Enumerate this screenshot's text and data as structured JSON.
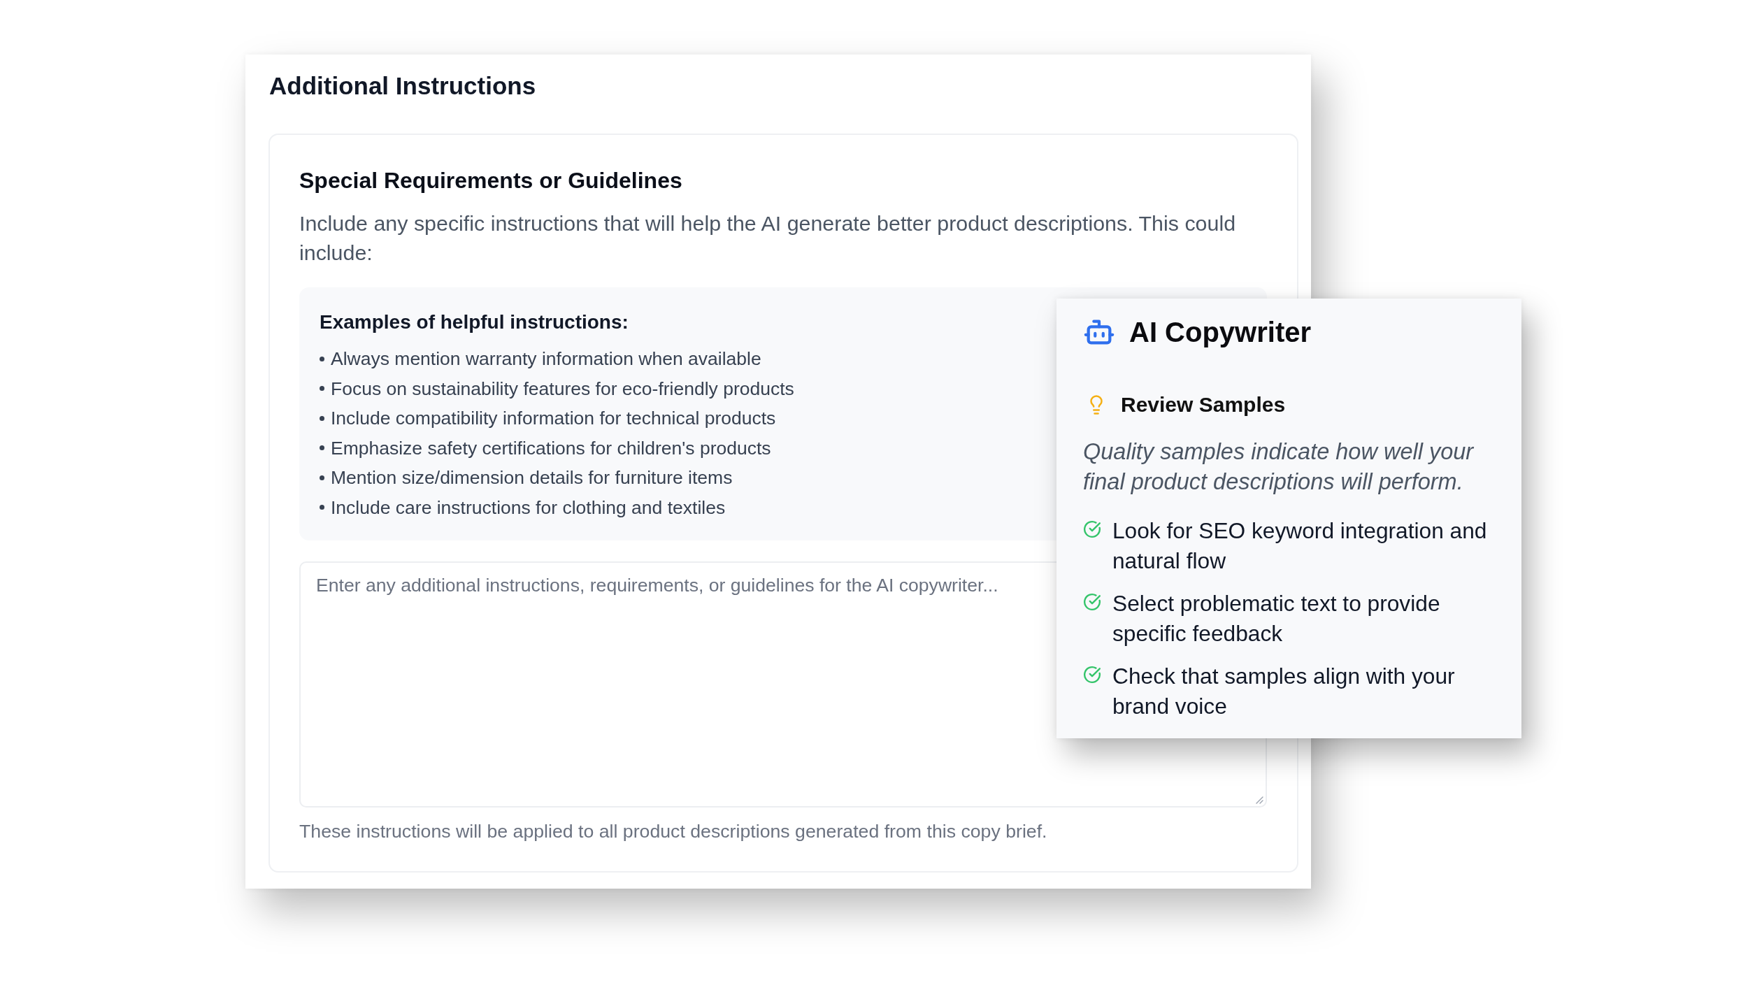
{
  "panel": {
    "title": "Additional Instructions",
    "card": {
      "heading": "Special Requirements or Guidelines",
      "description": "Include any specific instructions that will help the AI generate better product descriptions. This could include:",
      "examples": {
        "heading": "Examples of helpful instructions:",
        "items": [
          "Always mention warranty information when available",
          "Focus on sustainability features for eco-friendly products",
          "Include compatibility information for technical products",
          "Emphasize safety certifications for children's products",
          "Mention size/dimension details for furniture items",
          "Include care instructions for clothing and textiles"
        ]
      },
      "instructions_field": {
        "placeholder": "Enter any additional instructions, requirements, or guidelines for the AI copywriter..."
      },
      "help_text": "These instructions will be applied to all product descriptions generated from this copy brief."
    }
  },
  "assistant_popup": {
    "title": "AI Copywriter",
    "tip": {
      "heading": "Review Samples",
      "text": "Quality samples indicate how well your final product descriptions will perform.",
      "checklist": [
        "Look for SEO keyword integration and natural flow",
        "Select problematic text to provide specific feedback",
        "Check that samples align with your brand voice"
      ]
    }
  }
}
